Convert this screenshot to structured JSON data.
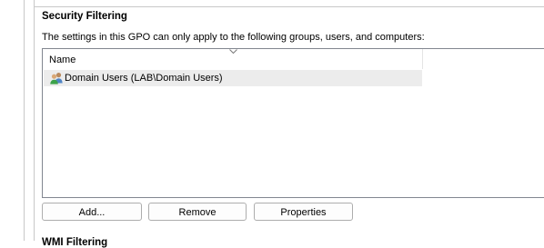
{
  "security_filtering": {
    "title": "Security Filtering",
    "description": "The settings in this GPO can only apply to the following groups, users, and computers:",
    "list": {
      "column_header": "Name",
      "rows": [
        {
          "label": "Domain Users (LAB\\Domain Users)",
          "icon": "user-group-icon"
        }
      ]
    },
    "buttons": {
      "add": "Add...",
      "remove": "Remove",
      "properties": "Properties"
    }
  },
  "next_section": {
    "title": "WMI Filtering"
  }
}
